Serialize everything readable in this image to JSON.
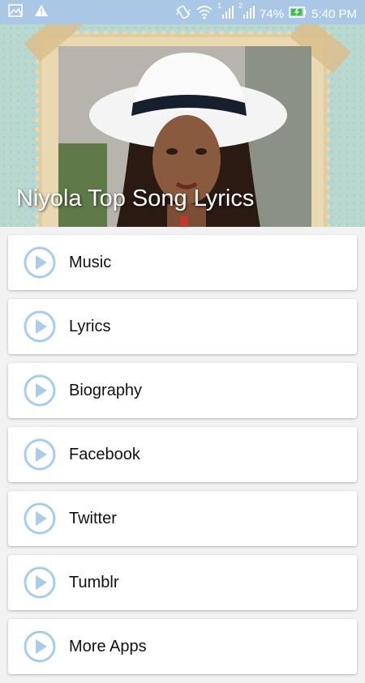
{
  "status_bar": {
    "battery": "74%",
    "time": "5:40 PM",
    "icons": [
      "image-icon",
      "warning-icon",
      "vibrate-icon",
      "wifi-icon",
      "signal-1-icon",
      "signal-2-icon",
      "battery-charging-icon"
    ],
    "signal_sim_1": "1",
    "signal_sim_2": "2"
  },
  "header": {
    "title": "Niyola Top Song Lyrics"
  },
  "menu": {
    "items": [
      {
        "label": "Music",
        "icon": "play-icon"
      },
      {
        "label": "Lyrics",
        "icon": "play-icon"
      },
      {
        "label": "Biography",
        "icon": "play-icon"
      },
      {
        "label": "Facebook",
        "icon": "play-icon"
      },
      {
        "label": "Twitter",
        "icon": "play-icon"
      },
      {
        "label": "Tumblr",
        "icon": "play-icon"
      },
      {
        "label": "More Apps",
        "icon": "play-icon"
      }
    ]
  },
  "colors": {
    "status_bar": "#aac8e6",
    "play_icon": "#a8cce9",
    "background": "#f2f2f2"
  }
}
